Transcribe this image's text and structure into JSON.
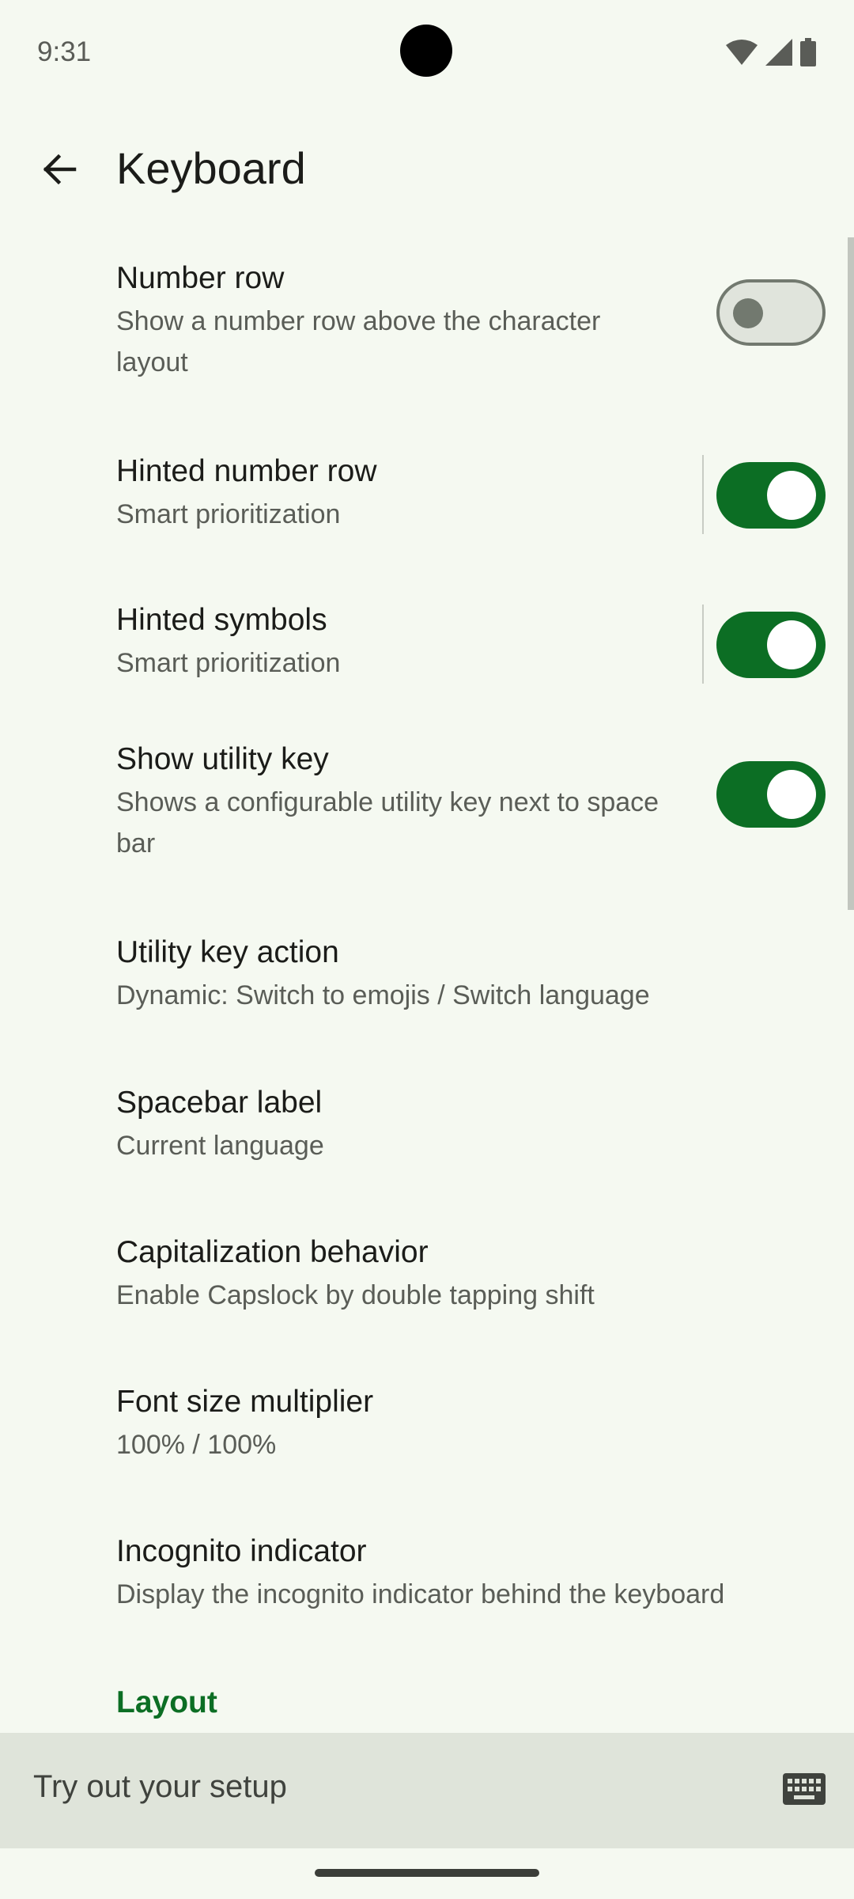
{
  "status": {
    "time": "9:31"
  },
  "header": {
    "title": "Keyboard"
  },
  "items": [
    {
      "title": "Number row",
      "subtitle": "Show a number row above the character layout",
      "toggle": false
    },
    {
      "title": "Hinted number row",
      "subtitle": "Smart prioritization",
      "toggle": true
    },
    {
      "title": "Hinted symbols",
      "subtitle": "Smart prioritization",
      "toggle": true
    },
    {
      "title": "Show utility key",
      "subtitle": "Shows a configurable utility key next to space bar",
      "toggle": true
    },
    {
      "title": "Utility key action",
      "subtitle": "Dynamic: Switch to emojis / Switch language"
    },
    {
      "title": "Spacebar label",
      "subtitle": "Current language"
    },
    {
      "title": "Capitalization behavior",
      "subtitle": "Enable Capslock by double tapping shift"
    },
    {
      "title": "Font size multiplier",
      "subtitle": "100% / 100%"
    },
    {
      "title": "Incognito indicator",
      "subtitle": "Display the incognito indicator behind the keyboard"
    }
  ],
  "section": {
    "layout_label": "Layout"
  },
  "tryout": {
    "placeholder": "Try out your setup"
  },
  "icons": {
    "back": "arrow-back-icon",
    "wifi": "wifi-icon",
    "signal": "cell-signal-icon",
    "battery": "battery-icon",
    "keyboard": "keyboard-icon"
  },
  "colors": {
    "accent": "#0c6e24",
    "background": "#f5f9f1",
    "tryout_bar": "#dfe4da"
  }
}
